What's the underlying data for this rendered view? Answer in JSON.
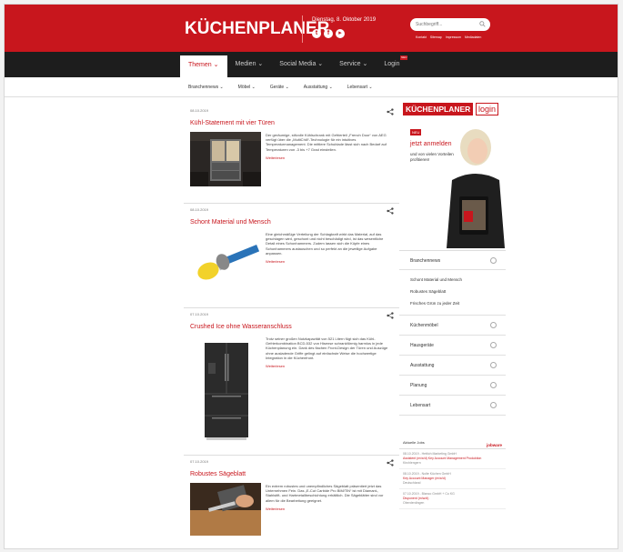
{
  "header": {
    "logo": "KÜCHENPLANER",
    "date": "Dienstag, 8. Oktober 2019",
    "search_placeholder": "Suchbegriff...",
    "links": [
      "Kontakt",
      "Sitemap",
      "Impressum",
      "Mediadaten"
    ]
  },
  "nav": {
    "items": [
      {
        "label": "Themen",
        "active": true
      },
      {
        "label": "Medien",
        "active": false
      },
      {
        "label": "Social Media",
        "active": false
      },
      {
        "label": "Service",
        "active": false
      },
      {
        "label": "Login",
        "active": false
      }
    ],
    "badge": "NEU"
  },
  "subnav": {
    "items": [
      "Branchennews",
      "Möbel",
      "Geräte",
      "Ausstattung",
      "Lebensart"
    ]
  },
  "articles": [
    {
      "date": "08.10.2019",
      "title": "Kühl-Statement mit vier Türen",
      "text": "Der geräumige, stilvolle Kühlschrank mit Gefrierteil „French Door“ von AEG verfügt über die „MultiChill“-Technologie für ein intuitives Temperaturmanagement. Die mittlere Schublade lässt sich nach Bedarf auf Temperaturen von -3 bis +7 Grad einstellen.",
      "more": "Weiterlesen"
    },
    {
      "date": "08.10.2019",
      "title": "Schont Material und Mensch",
      "text": "Eine gleichmäßige Verteilung der Schlagkraft wirkt das Material, auf das geschlagen wird, geschont und nicht beschädigt wird, ist das wesentliche Detail eines Schonhammers. Zudem lassen sich die Köpfe eines Schonhammers austauschen und so perfekt an die jeweilige Aufgabe anpassen.",
      "more": "Weiterlesen"
    },
    {
      "date": "07.10.2019",
      "title": "Crushed Ice ohne Wasseranschluss",
      "text": "Trotz seiner großen Nutzkapazität von 521 Litern fügt sich das Kühl-Gefrierkombination BCD-532 von Hisense schrankförmig harmlos in jede Küchenplanung ein. Dank des flachen Front-Design der Türen und Auszüge ohne ausladende Griffe gelingt auf einfachste Weise die hochwertige Integration in die Küchenfront.",
      "more": "Weiterlesen"
    },
    {
      "date": "07.10.2019",
      "title": "Robustes Sägeblatt",
      "text": "Ein extrem robustes und unempfindliches Sägeblatt präsentiert jetzt das Unternehmen Fein. Das „E-Cut Carbide Pro BIM/TiN“ ist mit Diamant-, Stahlstift- und Hartmetallbeschichtung erhältlich. Die Sägeblätter sind vor allem für die Bearbeitung geeignet.",
      "more": "Weiterlesen"
    }
  ],
  "promo": {
    "logo": "KÜCHENPLANER",
    "login": "login",
    "badge": "NEU",
    "headline": "jetzt anmelden",
    "subline": "und von vielen Vorteilen profitieren!"
  },
  "categories": {
    "first": "Branchennews",
    "sub": [
      "Schont Material und Mensch",
      "Robustes Sägeblatt",
      "Frisches Grün zu jeder Zeit"
    ],
    "rest": [
      "Küchenmöbel",
      "Hausgeräte",
      "Ausstattung",
      "Planung",
      "Lebensart"
    ]
  },
  "jobs": {
    "head": "Aktuelle Jobs",
    "brand": "jobware",
    "items": [
      {
        "date": "08.10.2019 - Hettich Marketing GmbH",
        "title": "Assistent (m/w/d) Key Account Management Produktion",
        "city": "Kirchlengern"
      },
      {
        "date": "08.10.2019 - Nolte Küchen GmbH",
        "title": "Key Account Manager (m/w/d)",
        "city": "Deutschland"
      },
      {
        "date": "07.10.2019 - Blanco GmbH + Co KG",
        "title": "Disponent (m/w/d)",
        "city": "Oberderdingen"
      }
    ]
  },
  "colors": {
    "brand_red": "#c8161d",
    "nav_black": "#1d1d1d"
  }
}
